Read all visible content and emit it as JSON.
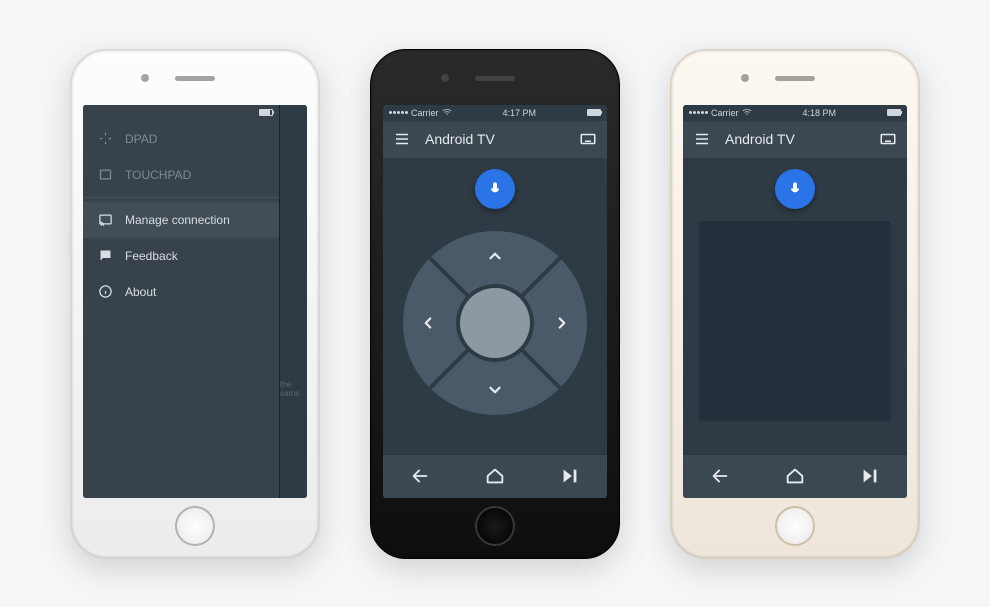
{
  "statusbar": {
    "carrier": "Carrier",
    "time2": "4:17 PM",
    "time3": "4:18 PM"
  },
  "app": {
    "title": "Android TV"
  },
  "drawer": {
    "dpad": "DPAD",
    "touchpad": "TOUCHPAD",
    "manage_connection": "Manage connection",
    "feedback": "Feedback",
    "about": "About",
    "peek_hint": "the same"
  },
  "icons": {
    "menu": "menu-icon",
    "keyboard": "keyboard-icon",
    "mic": "mic-icon",
    "back": "back-icon",
    "home": "home-icon",
    "playpause": "play-pause-icon"
  }
}
